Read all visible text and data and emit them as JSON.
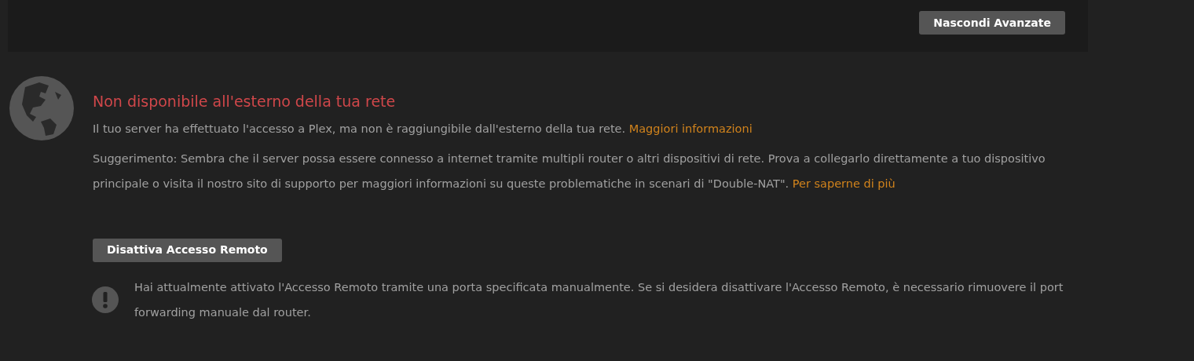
{
  "toolbar": {
    "button": "Nascondi Avanzate"
  },
  "status": {
    "title": "Non disponibile all'esterno della tua rete",
    "paragraphs": [
      {
        "text": "Il tuo server ha effettuato l'accesso a Plex, ma non è raggiungibile dall'esterno della tua rete.",
        "link": "Maggiori informazioni"
      },
      {
        "text": "Suggerimento: Sembra che il server possa essere connesso a internet tramite multipli router o altri dispositivi di rete. Prova a collegarlo direttamente a tuo dispositivo principale o visita il nostro sito di supporto per maggiori informazioni su queste problematiche in scenari di \"Double-NAT\".",
        "link": "Per saperne di più"
      }
    ]
  },
  "remote_access": {
    "button": "Disattiva Accesso Remoto",
    "note": "Hai attualmente attivato l'Accesso Remoto tramite una porta specificata manualmente. Se si desidera disattivare l'Accesso Remoto, è necessario rimuovere il port forwarding manuale dal router."
  }
}
